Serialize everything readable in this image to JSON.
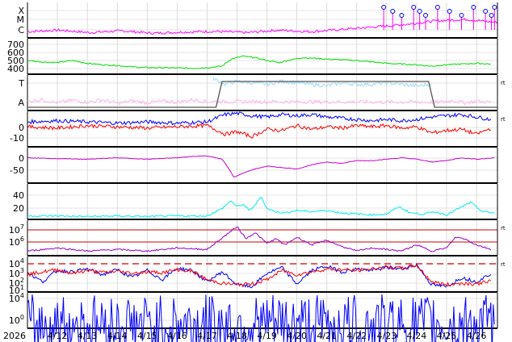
{
  "chart_data": {
    "type": "line",
    "title": "",
    "x_axis": {
      "year_label": "2026",
      "range": [
        "2026-04-11",
        "2026-04-26"
      ],
      "tick_labels": [
        "4/12",
        "4/13",
        "4/14",
        "4/15",
        "4/16",
        "4/17",
        "4/18",
        "4/19",
        "4/20",
        "4/21",
        "4/22",
        "4/23",
        "4/24",
        "4/25",
        "4/26"
      ]
    },
    "grid": true,
    "panels": [
      {
        "id": "xray_flares",
        "type": "line",
        "y_tick_labels": [
          "X",
          "M",
          "C"
        ],
        "series": [
          {
            "color": "#ff00ff",
            "values": [
              0.15,
              0.2,
              0.12,
              0.18,
              0.1,
              0.14,
              0.16,
              0.12,
              0.2,
              0.15,
              0.22,
              0.3,
              0.38,
              0.5,
              0.55,
              0.45
            ]
          }
        ],
        "markers": {
          "color": "#0000ff",
          "label": "o",
          "x_days": [
            22.9,
            23.2,
            23.5,
            23.9,
            24.1,
            24.3,
            24.7,
            25.1,
            25.5,
            25.9,
            26.3,
            26.5,
            26.6
          ]
        }
      },
      {
        "id": "solar_wind_speed",
        "type": "line",
        "y_tick_labels": [
          "700",
          "600",
          "500",
          "400"
        ],
        "ylim": [
          330,
          760
        ],
        "series": [
          {
            "color": "#00dd00",
            "x_days": [
              11.0,
              11.5,
              12.0,
              12.5,
              13.0,
              13.5,
              14.0,
              14.5,
              15.0,
              15.5,
              16.0,
              16.5,
              17.0,
              17.5,
              17.8,
              18.2,
              18.6,
              19.0,
              19.4,
              19.8,
              20.2,
              20.6,
              21.0,
              21.5,
              22.0,
              22.5,
              23.0,
              23.5,
              24.0,
              24.5,
              25.0,
              25.5,
              26.0,
              26.5
            ],
            "values": [
              500,
              480,
              470,
              500,
              460,
              440,
              430,
              410,
              400,
              400,
              395,
              390,
              400,
              420,
              520,
              560,
              540,
              500,
              470,
              510,
              540,
              530,
              520,
              510,
              500,
              480,
              460,
              450,
              440,
              420,
              440,
              450,
              460,
              450
            ]
          }
        ]
      },
      {
        "id": "imf_sector",
        "type": "line",
        "y_tick_labels": [
          "T",
          "A"
        ],
        "series": [
          {
            "name": "T",
            "color": "#99ddff",
            "x_days": [
              17.2,
              17.6,
              18.0,
              18.5,
              19.0,
              19.5,
              20.0,
              20.5,
              21.0,
              21.5,
              22.0,
              22.5,
              23.0,
              23.5,
              24.0,
              24.5
            ],
            "values": [
              1,
              0.8,
              0.9,
              0.85,
              0.8,
              0.9,
              0.85,
              0.8,
              0.75,
              0.85,
              0.8,
              0.8,
              0.85,
              0.8,
              0.75,
              0.8
            ]
          },
          {
            "name": "A",
            "color": "#ffb6e6",
            "x_days": [
              11.0,
              11.5,
              12.0,
              12.5,
              13.0,
              13.5,
              14.0,
              14.5,
              15.0,
              15.5,
              16.0,
              16.5,
              17.0,
              24.8,
              25.2,
              25.6,
              26.0,
              26.5
            ],
            "values": [
              0.25,
              0.3,
              0.2,
              0.28,
              0.22,
              0.3,
              0.18,
              0.26,
              0.2,
              0.25,
              0.22,
              0.3,
              0.24,
              0.22,
              0.28,
              0.2,
              0.25,
              0.22
            ]
          }
        ],
        "sector_line": {
          "color": "#555555",
          "points": [
            [
              11.0,
              0
            ],
            [
              17.3,
              0
            ],
            [
              17.5,
              1
            ],
            [
              24.4,
              1
            ],
            [
              24.6,
              0
            ],
            [
              26.7,
              0
            ]
          ]
        }
      },
      {
        "id": "imf_components",
        "type": "line",
        "y_tick_labels": [
          "0",
          "-10"
        ],
        "ylim": [
          -15,
          10
        ],
        "series": [
          {
            "name": "Bt",
            "color": "#0000ff",
            "x_days": [
              11.0,
              12.0,
              13.0,
              14.0,
              15.0,
              16.0,
              17.0,
              17.6,
              18.0,
              18.5,
              19.0,
              19.5,
              20.0,
              20.5,
              21.0,
              21.5,
              22.0,
              22.5,
              23.0,
              23.5,
              24.0,
              24.5,
              25.0,
              25.5,
              26.0,
              26.5
            ],
            "values": [
              4,
              5,
              4,
              3,
              4,
              3,
              4,
              10,
              11,
              9,
              8,
              10,
              9,
              10,
              8,
              7,
              6,
              5,
              6,
              5,
              6,
              8,
              9,
              10,
              8,
              6
            ]
          },
          {
            "name": "Bz",
            "color": "#ff0000",
            "x_days": [
              11.0,
              12.0,
              13.0,
              14.0,
              15.0,
              16.0,
              17.0,
              17.6,
              18.0,
              18.5,
              19.0,
              19.5,
              20.0,
              20.5,
              21.0,
              21.5,
              22.0,
              22.5,
              23.0,
              23.5,
              24.0,
              24.5,
              25.0,
              25.5,
              26.0,
              26.5
            ],
            "values": [
              0,
              -1,
              1,
              0,
              -1,
              0,
              1,
              -6,
              -4,
              -8,
              -2,
              -3,
              1,
              -2,
              0,
              -1,
              1,
              0,
              1,
              -1,
              0,
              -5,
              -3,
              -2,
              -6,
              -1
            ]
          }
        ]
      },
      {
        "id": "dst_index",
        "type": "line",
        "y_tick_labels": [
          "0",
          "-50"
        ],
        "ylim": [
          -90,
          20
        ],
        "series": [
          {
            "color": "#cc00cc",
            "x_days": [
              11.0,
              12.0,
              13.0,
              14.0,
              15.0,
              16.0,
              16.5,
              17.0,
              17.5,
              17.7,
              17.9,
              18.2,
              18.6,
              19.0,
              19.5,
              20.0,
              20.5,
              21.0,
              21.5,
              22.0,
              22.5,
              23.0,
              23.5,
              24.0,
              24.5,
              25.0,
              25.5,
              26.0,
              26.6
            ],
            "values": [
              -5,
              -8,
              -10,
              -5,
              -10,
              -5,
              0,
              2,
              -10,
              -40,
              -75,
              -60,
              -45,
              -35,
              -40,
              -45,
              -30,
              -20,
              -25,
              -15,
              -15,
              -10,
              -5,
              -10,
              -20,
              -15,
              -5,
              -10,
              -5
            ]
          }
        ]
      },
      {
        "id": "kp_like",
        "type": "line",
        "y_tick_labels": [
          "40",
          "20"
        ],
        "ylim": [
          0,
          50
        ],
        "series": [
          {
            "color": "#00eeee",
            "x_days": [
              11.0,
              12.0,
              13.0,
              14.0,
              15.0,
              16.0,
              17.0,
              17.5,
              17.8,
              18.0,
              18.2,
              18.4,
              18.6,
              18.8,
              19.0,
              19.3,
              19.6,
              20.0,
              20.5,
              21.0,
              21.5,
              22.0,
              22.5,
              23.0,
              23.4,
              23.8,
              24.2,
              24.6,
              25.0,
              25.4,
              25.8,
              26.2,
              26.6
            ],
            "values": [
              3,
              3,
              2,
              3,
              2,
              3,
              3,
              15,
              28,
              18,
              22,
              12,
              20,
              35,
              15,
              10,
              8,
              12,
              10,
              12,
              8,
              6,
              5,
              6,
              18,
              8,
              6,
              10,
              5,
              15,
              25,
              10,
              8
            ]
          }
        ]
      },
      {
        "id": "proton_flux",
        "type": "line",
        "y_tick_labels": [
          "10^7",
          "10^6"
        ],
        "thresholds": [
          {
            "color": "#cc0000",
            "label": "10^7"
          },
          {
            "color": "#cc0000",
            "label": "10^6"
          }
        ],
        "series": [
          {
            "color": "#9900cc",
            "x_days": [
              11.0,
              12.0,
              13.0,
              14.0,
              15.0,
              16.0,
              17.0,
              17.6,
              18.0,
              18.3,
              18.6,
              19.0,
              19.3,
              19.6,
              20.0,
              20.5,
              21.0,
              21.5,
              22.0,
              22.5,
              23.0,
              23.5,
              24.0,
              24.5,
              25.0,
              25.3,
              25.6,
              26.0,
              26.5
            ],
            "values": [
              0.1,
              0.2,
              0.1,
              0.15,
              0.1,
              0.2,
              0.15,
              0.6,
              0.9,
              0.5,
              0.7,
              0.35,
              0.5,
              0.3,
              0.55,
              0.3,
              0.45,
              0.25,
              0.1,
              0.2,
              0.15,
              0.1,
              0.3,
              0.1,
              0.2,
              0.55,
              0.5,
              0.3,
              0.15
            ]
          }
        ]
      },
      {
        "id": "electron_flux",
        "type": "line",
        "y_tick_labels": [
          "10^4",
          "10^3",
          "10^2",
          "10^1"
        ],
        "threshold": {
          "color": "#cc0000",
          "style": "dashed",
          "label": "10^4"
        },
        "series": [
          {
            "color": "#0000ff",
            "x_days": [
              11.0,
              11.5,
              12.0,
              12.5,
              13.0,
              13.5,
              14.0,
              14.5,
              15.0,
              15.5,
              16.0,
              16.5,
              17.0,
              17.5,
              18.0,
              18.5,
              19.0,
              19.5,
              20.0,
              20.5,
              21.0,
              21.5,
              22.0,
              22.5,
              23.0,
              23.5,
              24.0,
              24.5,
              25.0,
              25.5,
              26.0,
              26.5
            ],
            "values": [
              2.5,
              1.2,
              2.8,
              2.6,
              3.0,
              2.2,
              2.9,
              1.8,
              2.8,
              1.5,
              3.1,
              2.8,
              1.2,
              2.6,
              0.8,
              0.5,
              2.4,
              3.2,
              0.9,
              2.8,
              3.4,
              2.6,
              3.0,
              2.8,
              3.2,
              3.0,
              3.6,
              0.8,
              0.5,
              1.8,
              1.2,
              2.4
            ]
          },
          {
            "color": "#ff0000",
            "x_days": [
              11.0,
              11.5,
              12.0,
              12.5,
              13.0,
              13.5,
              14.0,
              14.5,
              15.0,
              15.5,
              16.0,
              16.5,
              17.0,
              17.5,
              18.0,
              18.5,
              19.0,
              19.5,
              20.0,
              20.5,
              21.0,
              21.5,
              22.0,
              22.5,
              23.0,
              23.5,
              24.0,
              24.5,
              25.0,
              25.5,
              26.0,
              26.5
            ],
            "values": [
              2.2,
              2.6,
              2.9,
              2.4,
              2.8,
              2.5,
              2.7,
              2.4,
              2.6,
              2.5,
              2.9,
              2.7,
              1.5,
              1.0,
              0.8,
              0.9,
              1.5,
              2.8,
              2.2,
              2.6,
              3.0,
              2.9,
              2.8,
              3.0,
              3.3,
              3.1,
              3.5,
              1.2,
              0.8,
              1.0,
              0.9,
              1.4
            ]
          }
        ]
      },
      {
        "id": "neutron",
        "type": "line",
        "y_tick_labels": [
          "10^4",
          "10^0"
        ],
        "series": [
          {
            "color": "#0000ff",
            "x_days": [
              11.0,
              13.0,
              15.0,
              17.0,
              19.0,
              21.0,
              23.0,
              25.0,
              26.6
            ],
            "values": [
              0.05,
              0.08,
              0.05,
              0.06,
              0.07,
              0.05,
              0.06,
              0.05,
              0.05
            ]
          }
        ]
      }
    ]
  }
}
